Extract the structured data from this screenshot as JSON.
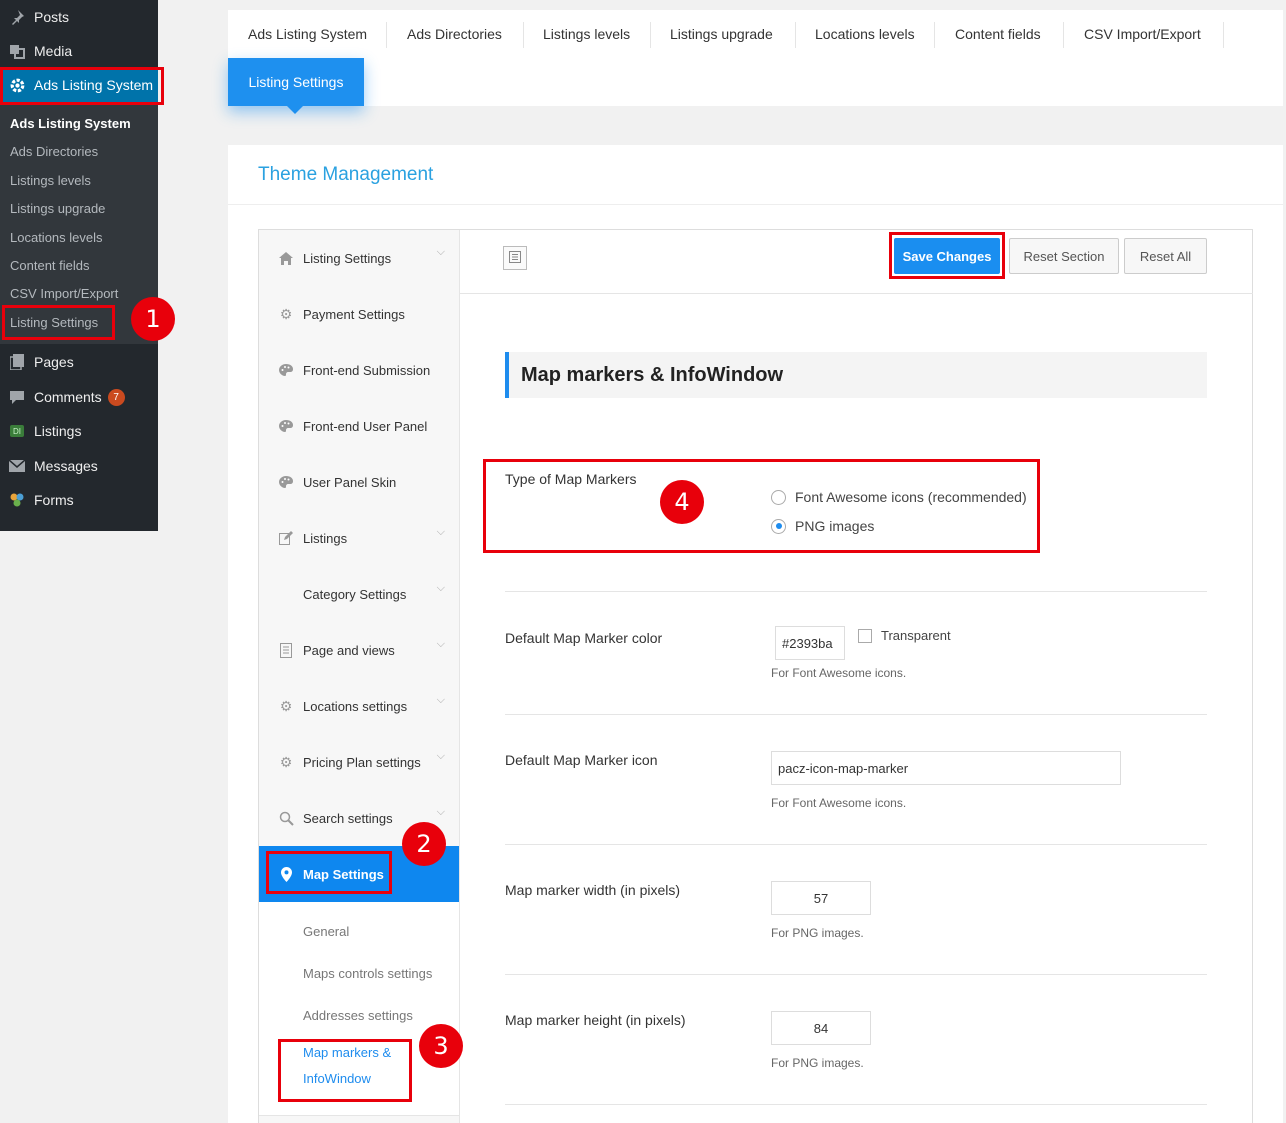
{
  "wp_menu": {
    "posts": "Posts",
    "media": "Media",
    "ads_listing_system": "Ads Listing System",
    "submenu": [
      "Ads Listing System",
      "Ads Directories",
      "Listings levels",
      "Listings upgrade",
      "Locations levels",
      "Content fields",
      "CSV Import/Export",
      "Listing Settings"
    ],
    "pages": "Pages",
    "comments": "Comments",
    "comments_count": "7",
    "listings": "Listings",
    "listings_icon_text": "DI",
    "messages": "Messages",
    "forms": "Forms"
  },
  "top_tabs": [
    "Ads Listing System",
    "Ads Directories",
    "Listings levels",
    "Listings upgrade",
    "Locations levels",
    "Content fields",
    "CSV Import/Export"
  ],
  "active_tab": "Listing Settings",
  "panel_title": "Theme Management",
  "left_menu": [
    {
      "label": "Listing Settings",
      "icon": "home-icon"
    },
    {
      "label": "Payment Settings",
      "icon": "gear-icon"
    },
    {
      "label": "Front-end Submission",
      "icon": "palette-icon"
    },
    {
      "label": "Front-end User Panel",
      "icon": "palette-icon"
    },
    {
      "label": "User Panel Skin",
      "icon": "palette-icon"
    },
    {
      "label": "Listings",
      "icon": "edit-icon"
    },
    {
      "label": "Category Settings",
      "icon": ""
    },
    {
      "label": "Page and views",
      "icon": "page-icon"
    },
    {
      "label": "Locations settings",
      "icon": "gear-icon"
    },
    {
      "label": "Pricing Plan settings",
      "icon": "gear-icon"
    },
    {
      "label": "Search settings",
      "icon": "search-icon"
    },
    {
      "label": "Map Settings",
      "icon": "map-pin-icon"
    }
  ],
  "map_submenu": [
    "General",
    "Maps controls settings",
    "Addresses settings",
    "Map markers &",
    "InfoWindow"
  ],
  "toolbar": {
    "save": "Save Changes",
    "reset_section": "Reset Section",
    "reset_all": "Reset All"
  },
  "section_title": "Map markers & InfoWindow",
  "fields": {
    "marker_type": {
      "label": "Type of Map Markers",
      "opt1": "Font Awesome icons (recommended)",
      "opt2": "PNG images",
      "selected": "PNG images"
    },
    "marker_color": {
      "label": "Default Map Marker color",
      "value": "#2393ba",
      "transparent_label": "Transparent",
      "help": "For Font Awesome icons."
    },
    "marker_icon": {
      "label": "Default Map Marker icon",
      "value": "pacz-icon-map-marker",
      "help": "For Font Awesome icons."
    },
    "marker_width": {
      "label": "Map marker width (in pixels)",
      "value": "57",
      "help": "For PNG images."
    },
    "marker_height": {
      "label": "Map marker height (in pixels)",
      "value": "84",
      "help": "For PNG images."
    }
  },
  "annotations": [
    "1",
    "2",
    "3",
    "4"
  ],
  "colors": {
    "accent": "#1e8cee",
    "highlight": "#e8000b",
    "wp_dark": "#23282d",
    "wp_blue": "#0073aa"
  }
}
